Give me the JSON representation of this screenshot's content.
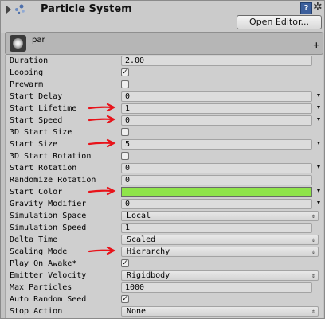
{
  "header": {
    "title": "Particle System",
    "open_editor_label": "Open Editor...",
    "help_icon": "?",
    "gear_icon": "✲"
  },
  "module": {
    "name": "par"
  },
  "colors": {
    "start_color": "#8fe44a",
    "annotation_arrow": "#e8131a"
  },
  "rows": [
    {
      "label": "Duration",
      "type": "num",
      "value": "2.00"
    },
    {
      "label": "Looping",
      "type": "check",
      "checked": true
    },
    {
      "label": "Prewarm",
      "type": "check",
      "checked": false
    },
    {
      "label": "Start Delay",
      "type": "num",
      "value": "0",
      "dropdown": true
    },
    {
      "label": "Start Lifetime",
      "type": "num",
      "value": "1",
      "dropdown": true,
      "annotated": true
    },
    {
      "label": "Start Speed",
      "type": "num",
      "value": "0",
      "dropdown": true,
      "annotated": true
    },
    {
      "label": "3D Start Size",
      "type": "check",
      "checked": false
    },
    {
      "label": "Start Size",
      "type": "num",
      "value": "5",
      "dropdown": true,
      "annotated": true
    },
    {
      "label": "3D Start Rotation",
      "type": "check",
      "checked": false
    },
    {
      "label": "Start Rotation",
      "type": "num",
      "value": "0",
      "dropdown": true
    },
    {
      "label": "Randomize Rotation",
      "type": "num",
      "value": "0"
    },
    {
      "label": "Start Color",
      "type": "color",
      "dropdown": true,
      "annotated": true
    },
    {
      "label": "Gravity Modifier",
      "type": "num",
      "value": "0",
      "dropdown": true
    },
    {
      "label": "Simulation Space",
      "type": "popup",
      "value": "Local"
    },
    {
      "label": "Simulation Speed",
      "type": "num",
      "value": "1"
    },
    {
      "label": "Delta Time",
      "type": "popup",
      "value": "Scaled"
    },
    {
      "label": "Scaling Mode",
      "type": "popup",
      "value": "Hierarchy",
      "annotated": true
    },
    {
      "label": "Play On Awake*",
      "type": "check",
      "checked": true
    },
    {
      "label": "Emitter Velocity",
      "type": "popup",
      "value": "Rigidbody"
    },
    {
      "label": "Max Particles",
      "type": "num",
      "value": "1000"
    },
    {
      "label": "Auto Random Seed",
      "type": "check",
      "checked": true
    },
    {
      "label": "Stop Action",
      "type": "popup",
      "value": "None"
    }
  ]
}
